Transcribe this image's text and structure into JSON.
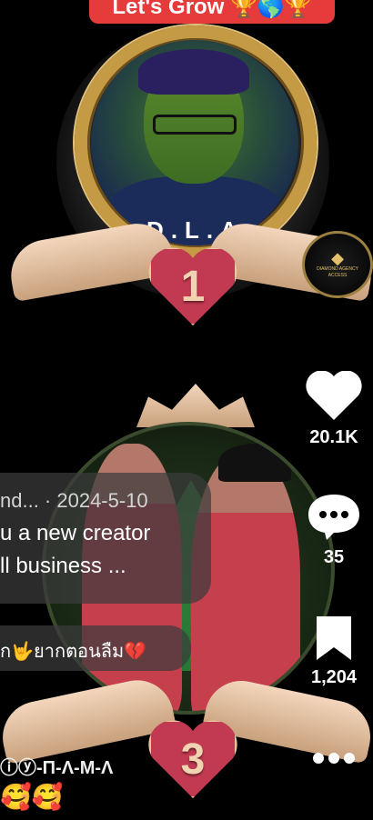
{
  "banner": {
    "text": "Let's Grow 🏆🌎🏆"
  },
  "badge_top": {
    "label": "D.L.A",
    "rank": "1"
  },
  "diamond_badge": {
    "icon": "diamond-icon",
    "text": "DIAMOND AGENCY ACCESS"
  },
  "badge_bottom": {
    "rank": "3"
  },
  "actions": {
    "like": {
      "icon": "heart-icon",
      "count": "20.1K"
    },
    "comment": {
      "icon": "comment-icon",
      "count": "35"
    },
    "save": {
      "icon": "bookmark-icon",
      "count": "1,204"
    },
    "more": {
      "icon": "more-icon"
    }
  },
  "caption": {
    "meta": "nd... · 2024-5-10",
    "line1": "u a new creator",
    "line2": "ll business ..."
  },
  "comment_preview": {
    "text": "ัก🤟ยากตอนลืม💔"
  },
  "bottom_user": {
    "name": "ⓘⓨ-П-Λ-M-Λ"
  },
  "bottom_emoji": {
    "text": "🥰🥰"
  },
  "colors": {
    "banner": "#e53b3b",
    "gold": "#c49a44",
    "heart": "#c23a52"
  }
}
